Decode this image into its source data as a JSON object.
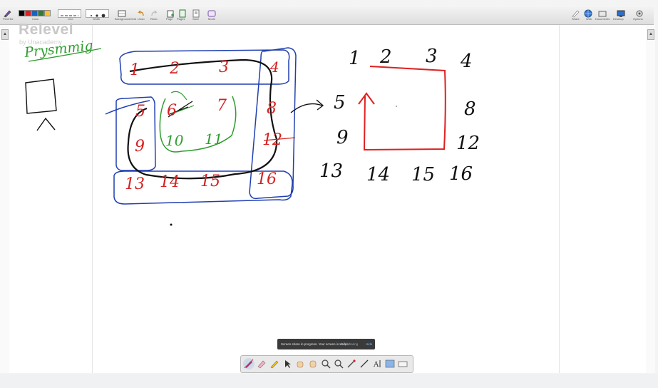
{
  "app": {
    "logo_text": "Relevel",
    "logo_sub": "by Unacademy"
  },
  "toolbar": {
    "labels": {
      "pen": "Pen/Hbr",
      "color": "Color",
      "line": "Line",
      "width": "Width",
      "background": "Background/Grid",
      "undo": "Undo",
      "redo": "Redo",
      "page": "Page",
      "pages": "Pages",
      "save": "Save",
      "mode": "Mode",
      "share": "Share",
      "web": "Web",
      "documents": "Documents",
      "desktop": "Desktop",
      "options": "Options"
    },
    "swatch_colors": [
      "#000000",
      "#e02020",
      "#1565c0",
      "#2e7d32",
      "#fbc02d"
    ]
  },
  "board": {
    "left_labels": [
      "1",
      "2",
      "3",
      "4",
      "5",
      "6",
      "7",
      "8",
      "9",
      "10",
      "11",
      "12",
      "13",
      "14",
      "15",
      "16"
    ],
    "right_labels": [
      "1",
      "2",
      "3",
      "4",
      "5",
      "8",
      "9",
      "12",
      "13",
      "14",
      "15",
      "16"
    ],
    "handwriting": "Prysmmig"
  },
  "notice": {
    "message": "Screen share in progress. Your screen is visible.",
    "stop": "Stop sharing",
    "hide": "Hide"
  },
  "tools": [
    "pen-tool",
    "eraser-tool",
    "highlighter-tool",
    "select-tool",
    "hand-tool",
    "pan-tool",
    "zoom-in-tool",
    "zoom-out-tool",
    "laser-tool",
    "line-tool",
    "text-tool",
    "image-tool",
    "keyboard-tool"
  ]
}
